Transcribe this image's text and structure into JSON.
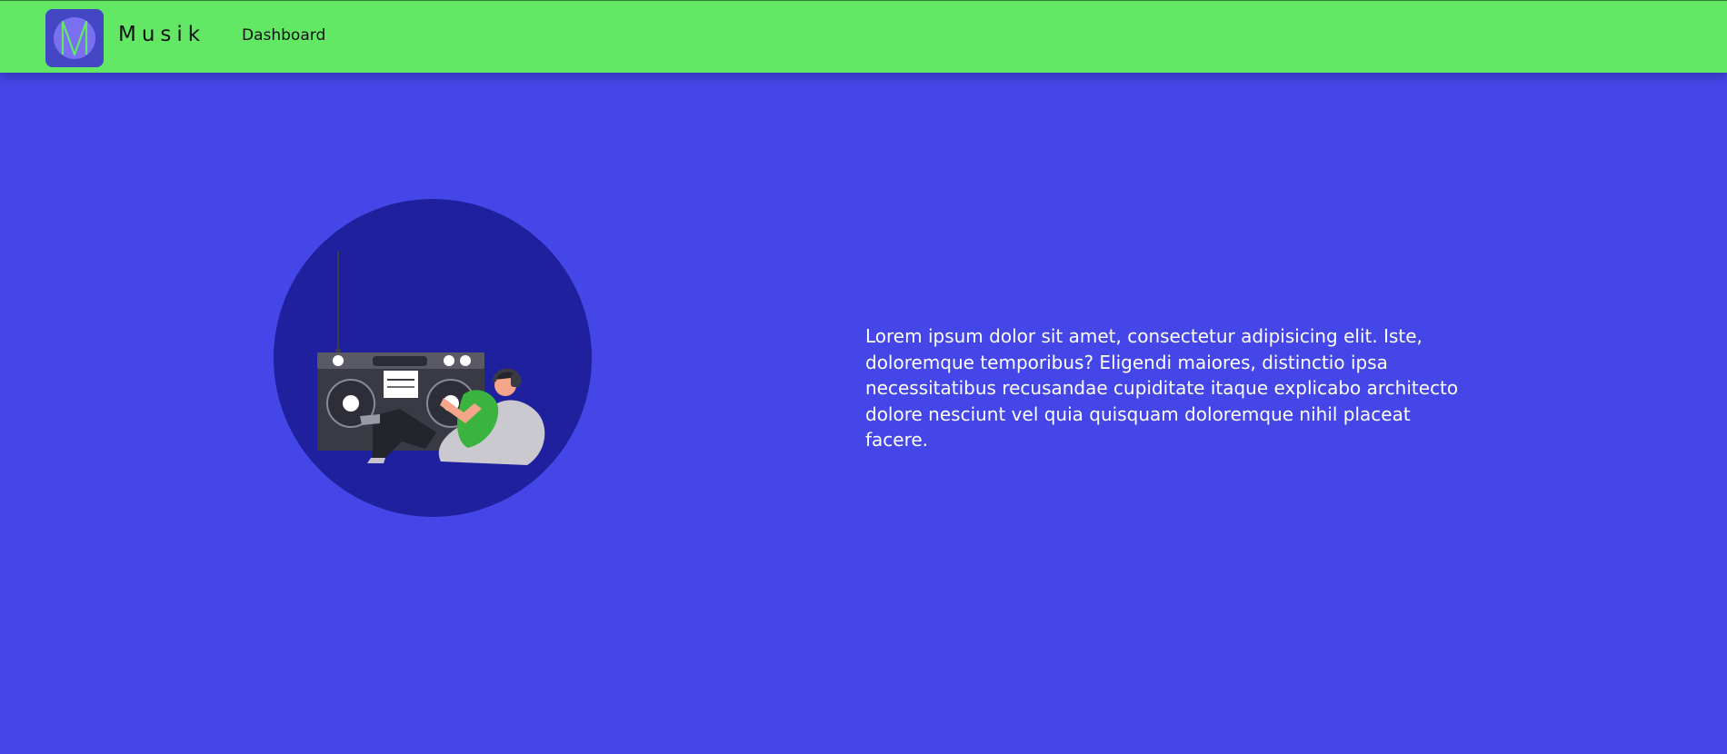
{
  "navbar": {
    "logo_letter": "M",
    "brand": "Musik",
    "nav_link": "Dashboard"
  },
  "hero": {
    "illustration_icon": "person-listening-to-boombox-illustration",
    "text": "Lorem ipsum dolor sit amet, consectetur adipisicing elit. Iste, doloremque temporibus? Eligendi maiores, distinctio ipsa necessitatibus recusandae cupiditate itaque explicabo architecto dolore nesciunt vel quia quisquam doloremque nihil placeat facere."
  },
  "colors": {
    "navbar_bg": "#62e865",
    "page_bg": "#4446e7",
    "logo_bg": "#4447c4",
    "illustration_circle": "#1f209d",
    "text": "#ffffff"
  }
}
